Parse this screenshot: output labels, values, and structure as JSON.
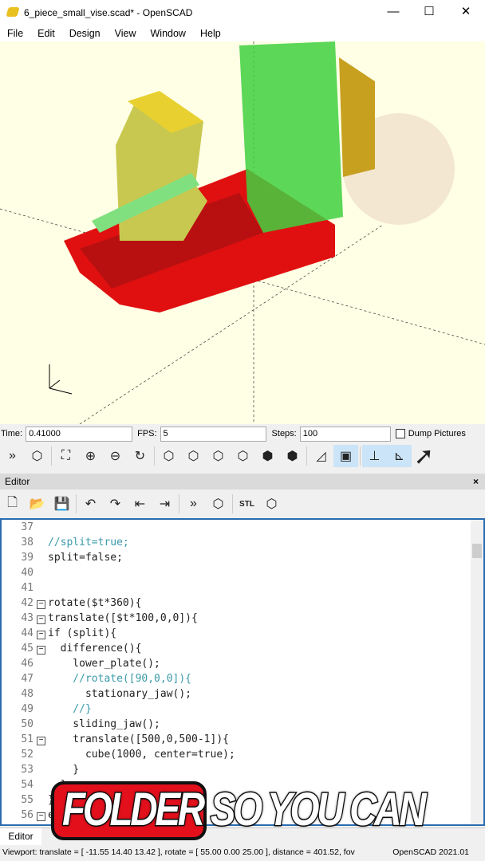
{
  "window": {
    "title": "6_piece_small_vise.scad* - OpenSCAD",
    "minimize": "—",
    "maximize": "☐",
    "close": "✕"
  },
  "menu": [
    "File",
    "Edit",
    "Design",
    "View",
    "Window",
    "Help"
  ],
  "animate": {
    "time_label": "Time:",
    "time_value": "0.41000",
    "fps_label": "FPS:",
    "fps_value": "5",
    "steps_label": "Steps:",
    "steps_value": "100",
    "dump_label": "Dump Pictures",
    "dump_checked": false
  },
  "view_toolbar": [
    "preview",
    "render",
    "view-all",
    "zoom-in",
    "zoom-out",
    "reset-view",
    "view-right",
    "view-top",
    "view-bottom",
    "view-left",
    "view-front",
    "view-back",
    "perspective",
    "orthogonal",
    "show-axes",
    "show-scale-markers"
  ],
  "editor": {
    "title": "Editor",
    "close": "×",
    "toolbar": [
      "new",
      "open",
      "save",
      "undo",
      "redo",
      "unindent",
      "indent",
      "preview",
      "render",
      "export-stl",
      "send-to-print"
    ],
    "lines": [
      {
        "n": "37",
        "t": ""
      },
      {
        "n": "38",
        "t": "//split=true;"
      },
      {
        "n": "39",
        "t": "split=false;"
      },
      {
        "n": "40",
        "t": ""
      },
      {
        "n": "41",
        "t": ""
      },
      {
        "n": "42",
        "t": "rotate($t*360){"
      },
      {
        "n": "43",
        "t": "translate([$t*100,0,0]){"
      },
      {
        "n": "44",
        "t": "if (split){"
      },
      {
        "n": "45",
        "t": "  difference(){"
      },
      {
        "n": "46",
        "t": "    lower_plate();"
      },
      {
        "n": "47",
        "t": "    //rotate([90,0,0]){"
      },
      {
        "n": "48",
        "t": "      stationary_jaw();"
      },
      {
        "n": "49",
        "t": "    //}"
      },
      {
        "n": "50",
        "t": "    sliding_jaw();"
      },
      {
        "n": "51",
        "t": "    translate([500,0,500-1]){"
      },
      {
        "n": "52",
        "t": "      cube(1000, center=true);"
      },
      {
        "n": "53",
        "t": "    }"
      },
      {
        "n": "54",
        "t": "  }"
      },
      {
        "n": "55",
        "t": "}"
      },
      {
        "n": "56",
        "t": "e"
      }
    ]
  },
  "tabs": {
    "editor": "Editor"
  },
  "status": {
    "viewport": "Viewport: translate = [ -11.55 14.40 13.42 ], rotate = [ 55.00 0.00 25.00 ], distance = 401.52, fov",
    "version": "OpenSCAD 2021.01"
  },
  "caption": "FOLDER SO YOU CAN"
}
